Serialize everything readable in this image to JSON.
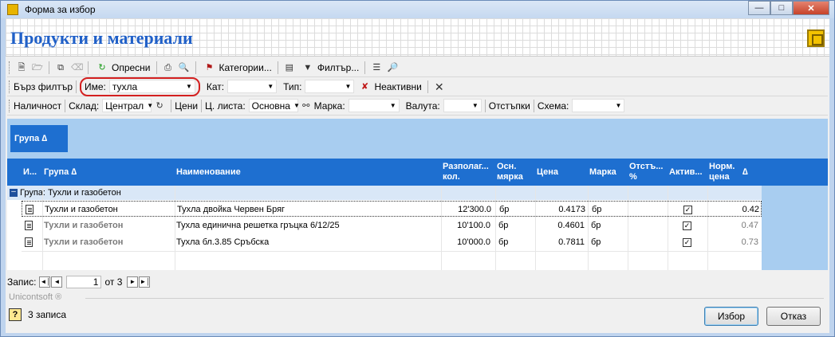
{
  "window": {
    "title": "Форма за избор",
    "minimize_icon": "minimize-icon",
    "maximize_icon": "maximize-icon",
    "close_icon": "close-icon"
  },
  "header": {
    "title": "Продукти и материали"
  },
  "toolbar1": {
    "refresh": "Опресни",
    "categories": "Категории...",
    "filters": "Филтър..."
  },
  "toolbar2": {
    "quick_filter": "Бърз филтър",
    "name_label": "Име:",
    "name_value": "тухла",
    "cat_label": "Кат:",
    "type_label": "Тип:",
    "inactive": "Неактивни"
  },
  "toolbar3": {
    "availability": "Наличност",
    "warehouse_label": "Склад:",
    "warehouse_value": "Централ",
    "prices": "Цени",
    "pricelist_label": "Ц. листа:",
    "pricelist_value": "Основна",
    "brand_label": "Марка:",
    "currency_label": "Валута:",
    "discounts": "Отстъпки",
    "scheme_label": "Схема:"
  },
  "group_panel": {
    "chip": "Група ∆"
  },
  "grid": {
    "columns": [
      "И...",
      "Група ∆",
      "Наименование",
      "Разполаг...\nкол.",
      "Осн.\nмярка",
      "Цена",
      "Марка",
      "Отстъ...\n%",
      "Актив...",
      "Норм.\nцена",
      "∆"
    ],
    "group_row": "Група: Тухли и газобетон",
    "rows": [
      {
        "group": "Тухли и газобетон",
        "name": "Тухла двойка Червен Бряг",
        "qty": "12'300.0",
        "unit": "бр",
        "price": "0.4173",
        "mark": "бр",
        "active": true,
        "norm": "0.42"
      },
      {
        "group": "Тухли и газобетон",
        "name": "Тухла единична решетка гръцка 6/12/25",
        "qty": "10'100.0",
        "unit": "бр",
        "price": "0.4601",
        "mark": "бр",
        "active": true,
        "norm": "0.47"
      },
      {
        "group": "Тухли и газобетон",
        "name": "Тухла бл.3.85 Сръбска",
        "qty": "10'000.0",
        "unit": "бр",
        "price": "0.7811",
        "mark": "бр",
        "active": true,
        "norm": "0.73"
      }
    ]
  },
  "navigator": {
    "label": "Запис:",
    "current": "1",
    "of_total": "от 3"
  },
  "footer": {
    "brand": "Unicontsoft ®",
    "status": "3 записа",
    "ok": "Избор",
    "cancel": "Отказ"
  }
}
